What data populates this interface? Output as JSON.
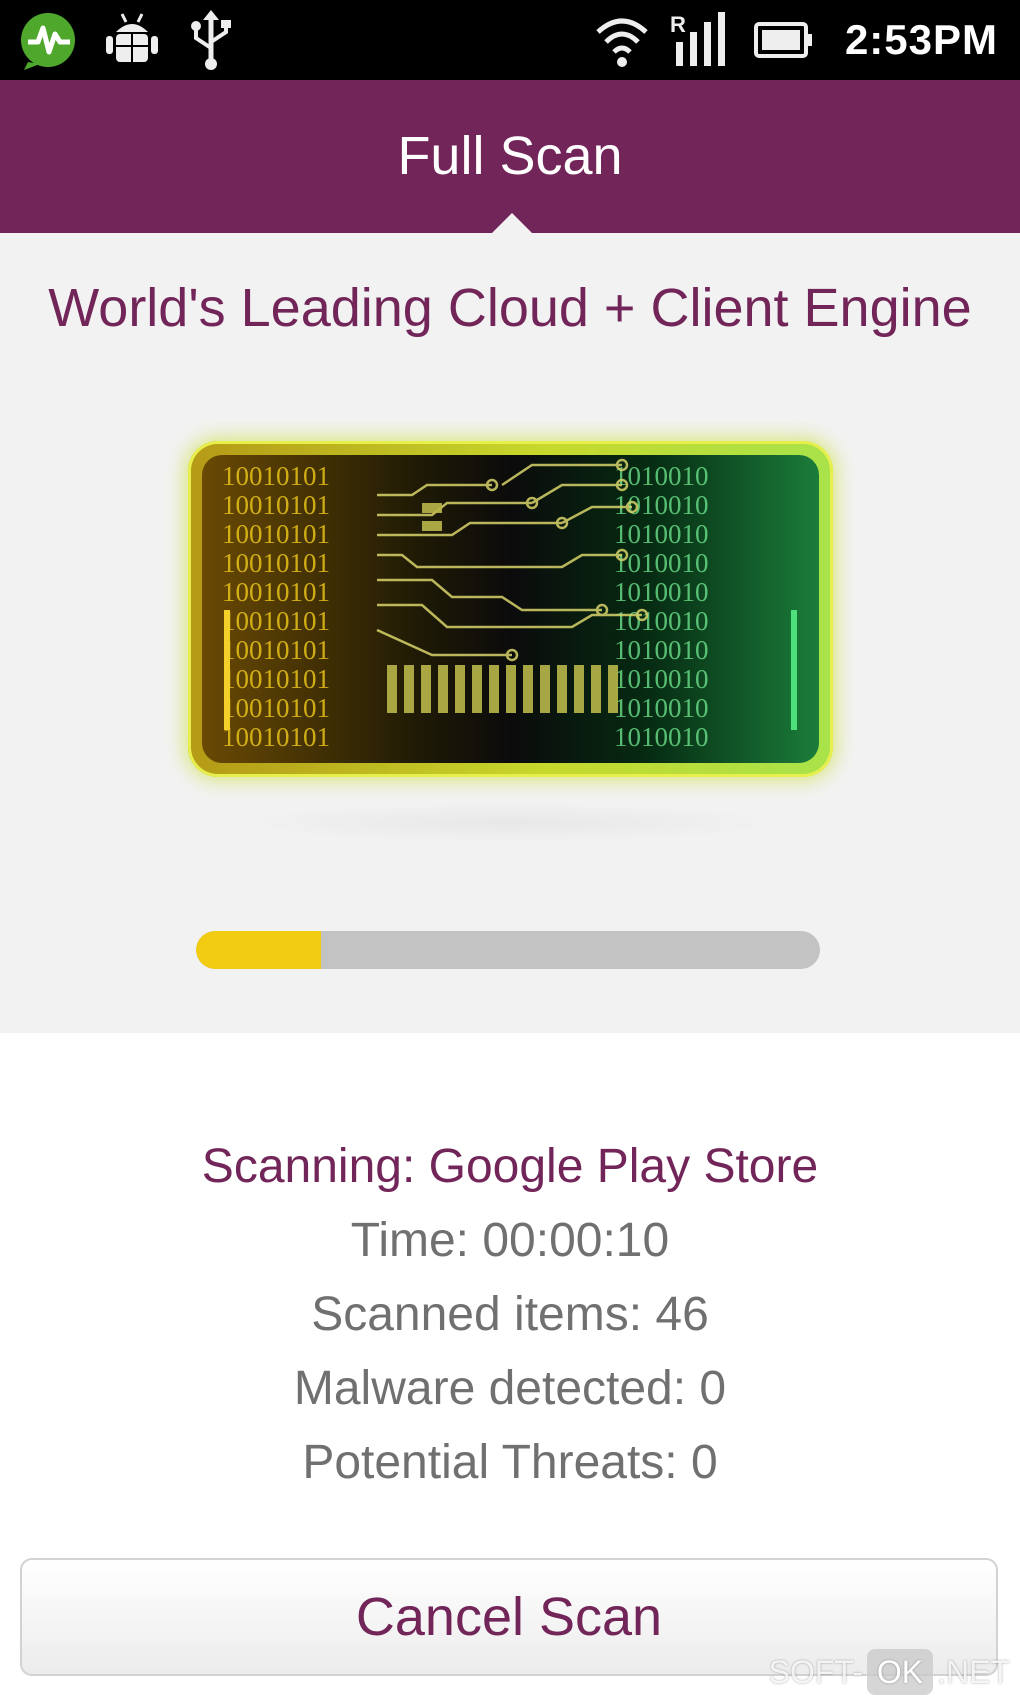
{
  "status_bar": {
    "time": "2:53PM",
    "icons": [
      "activity-chat-icon",
      "android-bug-icon",
      "usb-icon",
      "wifi-icon",
      "roaming-signal-icon",
      "battery-icon"
    ],
    "signal_label": "R"
  },
  "header": {
    "title": "Full Scan"
  },
  "hero": {
    "tagline": "World's Leading Cloud + Client Engine",
    "binary_left": [
      "10010101",
      "10010101",
      "10010101",
      "10010101",
      "10010101",
      "10010101",
      "10010101",
      "10010101",
      "10010101",
      "10010101"
    ],
    "binary_right": [
      "1010010",
      "1010010",
      "1010010",
      "1010010",
      "1010010",
      "1010010",
      "1010010",
      "1010010",
      "1010010",
      "1010010"
    ]
  },
  "progress": {
    "value": 0.2,
    "fill_color": "#f2cc13",
    "track_color": "#c3c3c3"
  },
  "scan_info": {
    "current": "Scanning: Google Play Store",
    "time": "Time: 00:00:10",
    "scanned_items": "Scanned items: 46",
    "malware": "Malware detected: 0",
    "threats": "Potential Threats: 0"
  },
  "cancel_button": {
    "label": "Cancel Scan"
  },
  "watermark": {
    "prefix": "SOFT-",
    "box": "OK",
    "suffix": ".NET"
  },
  "colors": {
    "brand": "#722558",
    "status_bar": "#000000",
    "hero_background": "#f2f2f2",
    "secondary_text": "#707070"
  }
}
